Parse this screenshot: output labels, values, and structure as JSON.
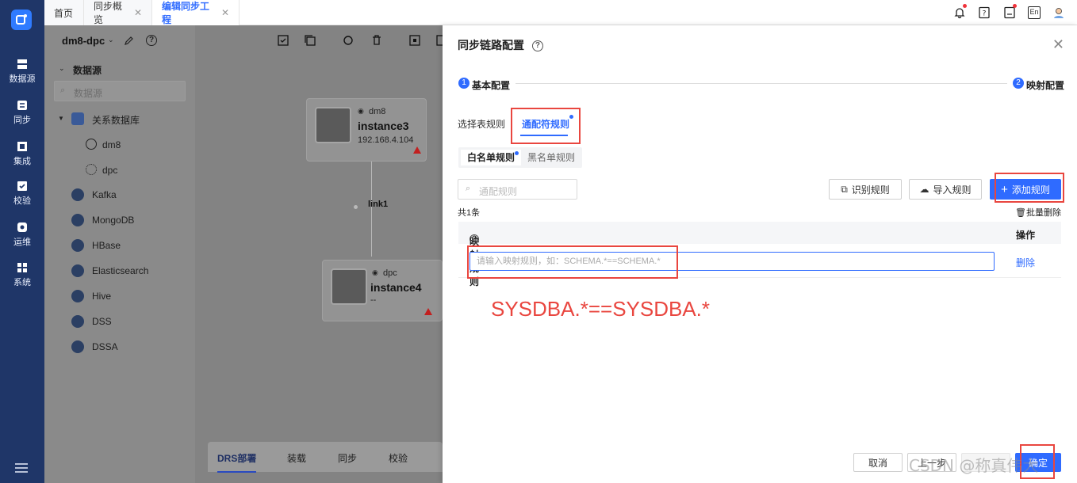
{
  "nav": {
    "items": [
      {
        "label": "数据源",
        "icon": "database-icon"
      },
      {
        "label": "同步",
        "icon": "sync-icon"
      },
      {
        "label": "集成",
        "icon": "integration-icon"
      },
      {
        "label": "校验",
        "icon": "check-icon"
      },
      {
        "label": "运维",
        "icon": "ops-icon"
      },
      {
        "label": "系统",
        "icon": "system-icon"
      }
    ]
  },
  "tabs": [
    {
      "label": "首页",
      "closable": false
    },
    {
      "label": "同步概览",
      "closable": true
    },
    {
      "label": "编辑同步工程",
      "closable": true,
      "active": true
    }
  ],
  "topbar": {
    "lang_label": "En"
  },
  "left_panel": {
    "project_name": "dm8-dpc",
    "section_title": "数据源",
    "search_placeholder": "数据源",
    "tree": {
      "group": "关系数据库",
      "children": [
        "dm8",
        "dpc"
      ],
      "others": [
        "Kafka",
        "MongoDB",
        "HBase",
        "Elasticsearch",
        "Hive",
        "DSS",
        "DSSA"
      ]
    }
  },
  "canvas": {
    "node1": {
      "tag": "dm8",
      "title": "instance3",
      "ip": "192.168.4.104"
    },
    "link": "link1",
    "node2": {
      "tag": "dpc",
      "title": "instance4",
      "ip": "--"
    },
    "bottom_tabs": [
      "DRS部署",
      "装载",
      "同步",
      "校验"
    ]
  },
  "drawer": {
    "title": "同步链路配置",
    "steps": [
      {
        "num": "1",
        "label": "基本配置"
      },
      {
        "num": "2",
        "label": "映射配置"
      }
    ],
    "sub_tabs": [
      "选择表规则",
      "通配符规则"
    ],
    "segment": [
      "白名单规则",
      "黑名单规则"
    ],
    "filter_placeholder": "通配规则",
    "buttons": {
      "identify": "识别规则",
      "import": "导入规则",
      "add": "添加规则"
    },
    "count": "共1条",
    "batch_delete": "批量删除",
    "table": {
      "col_rule": "映射规则",
      "col_action": "操作",
      "row_placeholder": "请输入映射规则，如：SCHEMA.*==SCHEMA.*",
      "row_action": "删除"
    },
    "annotation": "SYSDBA.*==SYSDBA.*",
    "footer": {
      "cancel": "取消",
      "prev": "上一步",
      "confirm": "确定"
    },
    "watermark": "CSDN @称真伟大"
  },
  "colors": {
    "accent": "#2f6bff",
    "nav_bg": "#1f3668",
    "highlight": "#e9463f"
  }
}
